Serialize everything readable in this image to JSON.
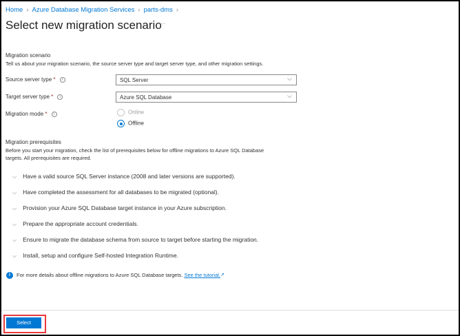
{
  "breadcrumb": [
    "Home",
    "Azure Database Migration Services",
    "parts-dms"
  ],
  "title": "Select new migration scenario",
  "more": "···",
  "scenario": {
    "heading": "Migration scenario",
    "description": "Tell us about your migration scenario, the source server type and target server type, and other migration settings."
  },
  "fields": {
    "source": {
      "label": "Source server type",
      "value": "SQL Server"
    },
    "target": {
      "label": "Target server type",
      "value": "Azure SQL Database"
    },
    "mode": {
      "label": "Migration mode",
      "options": [
        "Online",
        "Offline"
      ],
      "selected": "Offline"
    }
  },
  "prereq": {
    "heading": "Migration prerequisites",
    "description1": "Before you start your migration, check the list of prerequisites below for offline migrations to Azure SQL Database",
    "description2": "targets. All prerequisites are required.",
    "items": [
      "Have a valid source SQL Server instance (2008 and later versions are supported).",
      "Have completed the assessment for all databases to be migrated (optional).",
      "Provision your Azure SQL Database target instance in your Azure subscription.",
      "Prepare the appropriate account credentials.",
      "Ensure to migrate the database schema from source to target before starting the migration.",
      "Install, setup and configure Self-hosted Integration Runtime."
    ]
  },
  "info": {
    "text": "For more details about offline migrations to Azure SQL Database targets.",
    "link": "See the tutorial."
  },
  "select_label": "Select"
}
